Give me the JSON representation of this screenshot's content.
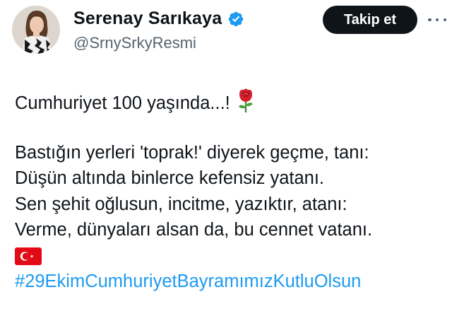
{
  "author": {
    "display_name": "Serenay Sarıkaya",
    "handle": "@SrnySrkyResmi",
    "verified": true
  },
  "follow_button": {
    "label": "Takip et"
  },
  "tweet": {
    "line1": "Cumhuriyet 100 yaşında...!",
    "line1_emoji": "rose-icon",
    "poem": [
      "Bastığın yerleri 'toprak!' diyerek geçme, tanı:",
      "Düşün altında binlerce kefensiz yatanı.",
      "Sen şehit oğlusun, incitme, yazıktır, atanı:",
      "Verme, dünyaları alsan da, bu cennet vatanı."
    ],
    "flag_emoji": "turkey-flag-icon",
    "hashtag": "#29EkimCumhuriyetBayramımızKutluOlsun"
  },
  "colors": {
    "text": "#0f1419",
    "secondary": "#536471",
    "link": "#1d9bf0",
    "verified": "#1d9bf0",
    "button_bg": "#0f1419",
    "button_text": "#ffffff",
    "flag_red": "#e30a17"
  }
}
